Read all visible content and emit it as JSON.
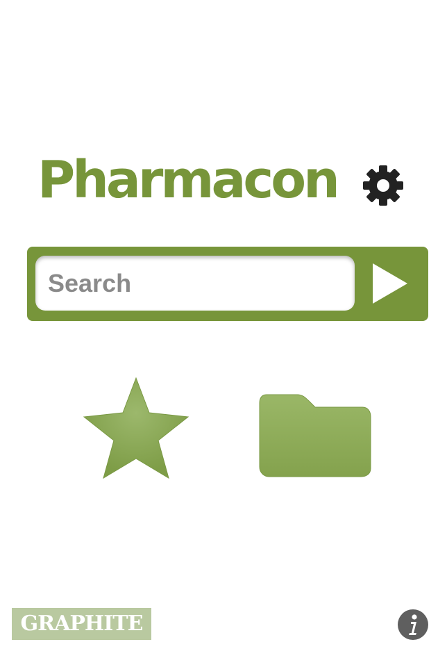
{
  "app": {
    "title": "Pharmacon"
  },
  "header": {
    "settings_icon": "gear-icon"
  },
  "search": {
    "value": "",
    "placeholder": "Search",
    "submit_icon": "play-arrow-icon"
  },
  "main": {
    "favorites_icon": "star-icon",
    "browse_icon": "folder-icon"
  },
  "footer": {
    "badge_label": "GRAPHITE",
    "info_icon": "info-icon"
  },
  "colors": {
    "accent": "#77953a",
    "icon_fill": "#86a552",
    "badge_bg": "#b9c9a0",
    "gear": "#222222",
    "info": "#5f5f5f"
  }
}
